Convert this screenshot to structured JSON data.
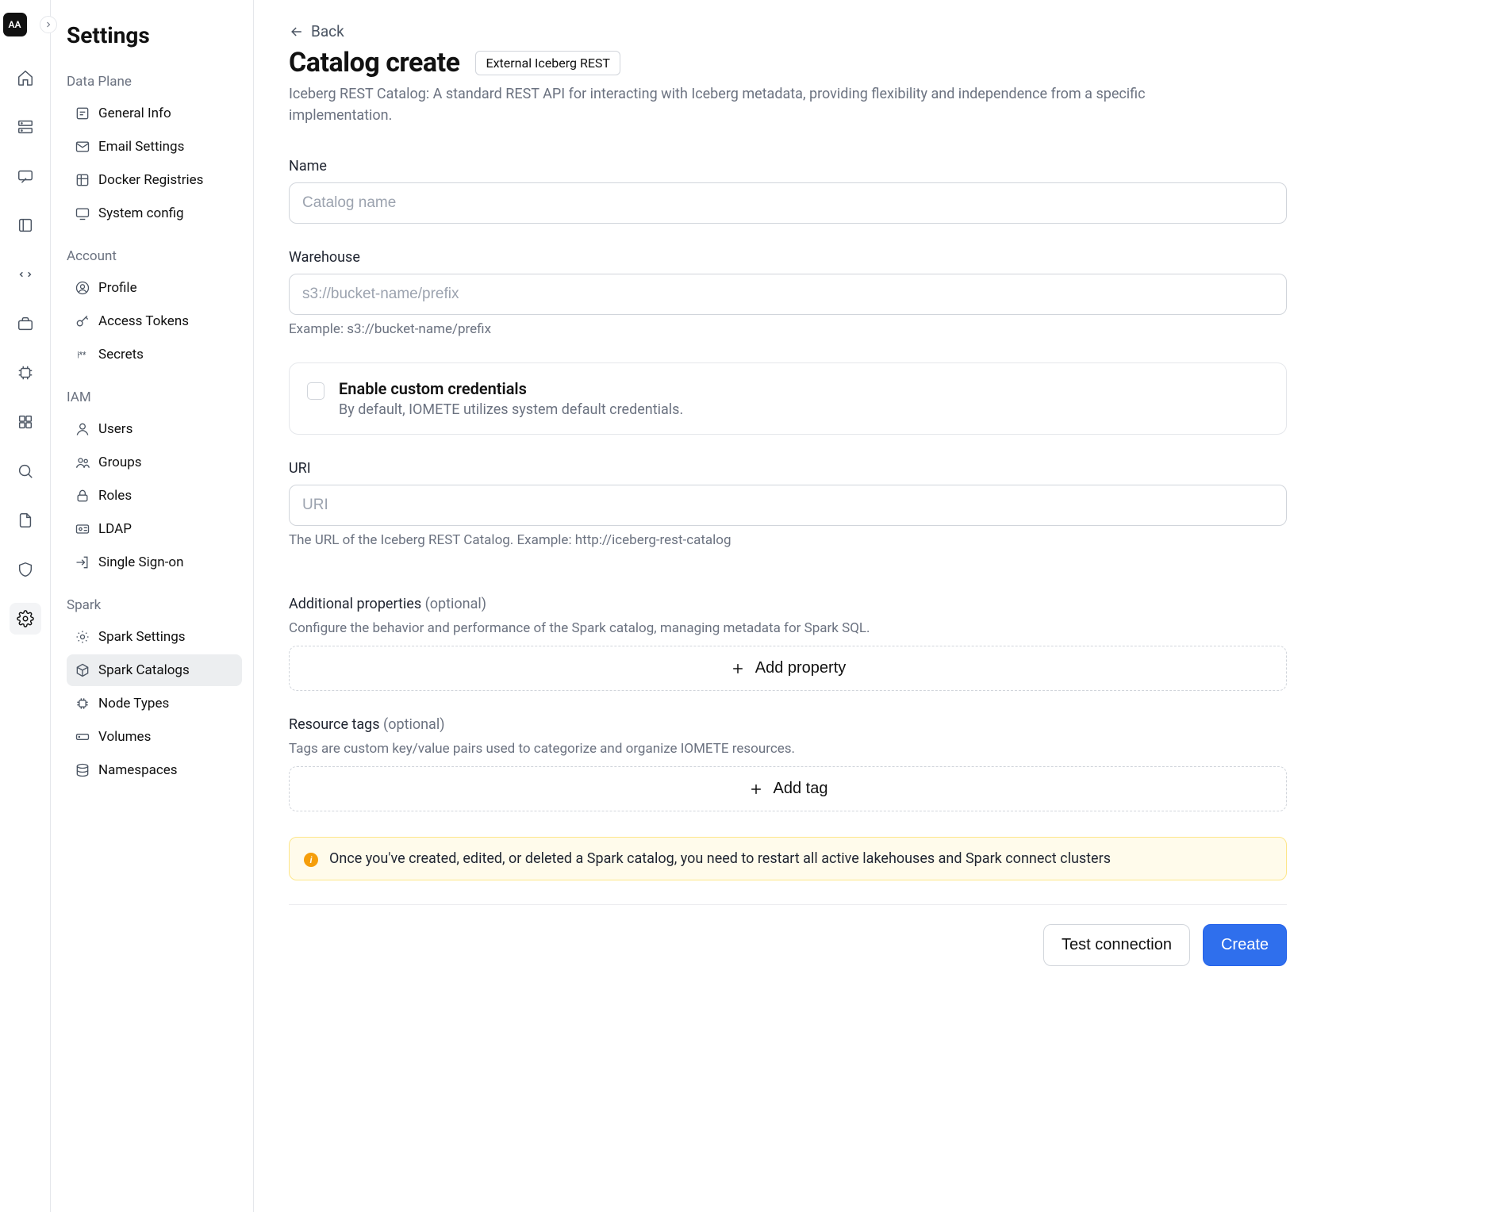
{
  "rail": {
    "avatar": "AA"
  },
  "sidebar": {
    "title": "Settings",
    "groups": [
      {
        "title": "Data Plane",
        "items": [
          {
            "label": "General Info"
          },
          {
            "label": "Email Settings"
          },
          {
            "label": "Docker Registries"
          },
          {
            "label": "System config"
          }
        ]
      },
      {
        "title": "Account",
        "items": [
          {
            "label": "Profile"
          },
          {
            "label": "Access Tokens"
          },
          {
            "label": "Secrets"
          }
        ]
      },
      {
        "title": "IAM",
        "items": [
          {
            "label": "Users"
          },
          {
            "label": "Groups"
          },
          {
            "label": "Roles"
          },
          {
            "label": "LDAP"
          },
          {
            "label": "Single Sign-on"
          }
        ]
      },
      {
        "title": "Spark",
        "items": [
          {
            "label": "Spark Settings"
          },
          {
            "label": "Spark Catalogs",
            "active": true
          },
          {
            "label": "Node Types"
          },
          {
            "label": "Volumes"
          },
          {
            "label": "Namespaces"
          }
        ]
      }
    ]
  },
  "page": {
    "back": "Back",
    "title": "Catalog create",
    "badge": "External Iceberg REST",
    "subtitle": "Iceberg REST Catalog: A standard REST API for interacting with Iceberg metadata, providing flexibility and independence from a specific implementation.",
    "name_label": "Name",
    "name_placeholder": "Catalog name",
    "warehouse_label": "Warehouse",
    "warehouse_placeholder": "s3://bucket-name/prefix",
    "warehouse_help": "Example: s3://bucket-name/prefix",
    "creds_title": "Enable custom credentials",
    "creds_desc": "By default, IOMETE utilizes system default credentials.",
    "uri_label": "URI",
    "uri_placeholder": "URI",
    "uri_help": "The URL of the Iceberg REST Catalog. Example: http://iceberg-rest-catalog",
    "addprops_label": "Additional properties",
    "addprops_opt": "(optional)",
    "addprops_desc": "Configure the behavior and performance of the Spark catalog, managing metadata for Spark SQL.",
    "addprops_button": "Add property",
    "tags_label": "Resource tags",
    "tags_opt": "(optional)",
    "tags_desc": "Tags are custom key/value pairs used to categorize and organize IOMETE resources.",
    "tags_button": "Add tag",
    "alert": "Once you've created, edited, or deleted a Spark catalog, you need to restart all active lakehouses and Spark connect clusters",
    "test_connection": "Test connection",
    "create": "Create"
  }
}
